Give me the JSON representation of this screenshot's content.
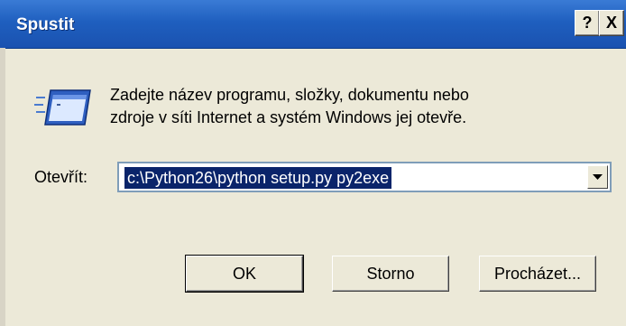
{
  "window": {
    "title": "Spustit",
    "help_label": "?",
    "close_label": "X"
  },
  "prompt": {
    "line1": "Zadejte název programu, složky, dokumentu nebo",
    "line2": "zdroje v síti Internet a systém Windows jej otevře."
  },
  "open_field": {
    "label": "Otevřít:",
    "value": "c:\\Python26\\python setup.py py2exe"
  },
  "buttons": {
    "ok": "OK",
    "cancel": "Storno",
    "browse": "Procházet..."
  },
  "icons": {
    "run": "run-dialog-icon",
    "dropdown": "chevron-down-icon"
  }
}
